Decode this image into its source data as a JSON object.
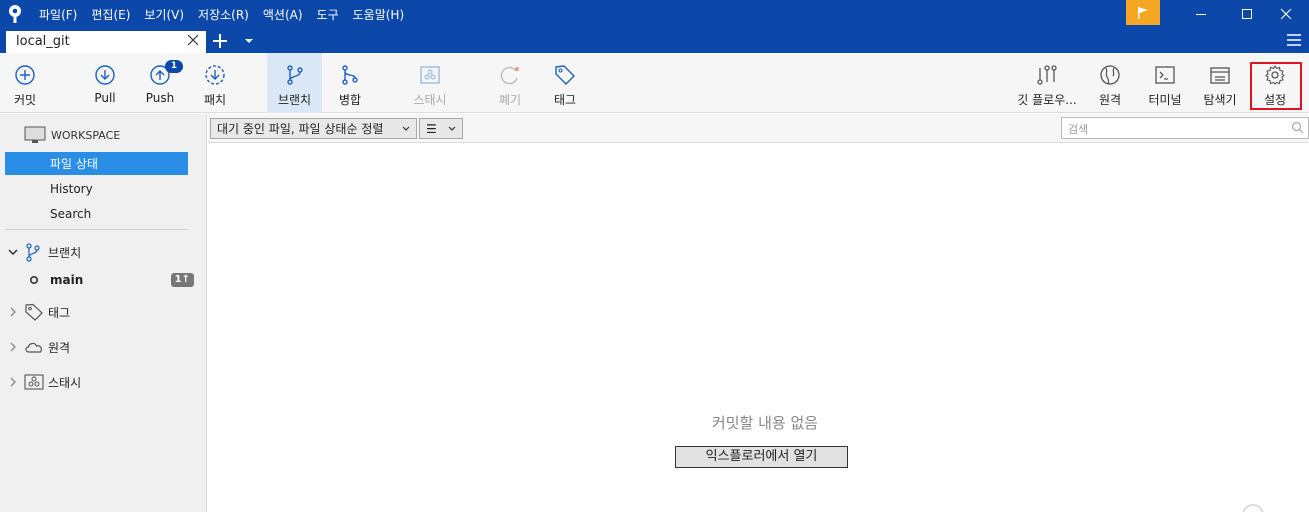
{
  "menubar": {
    "items": [
      "파일(F)",
      "편집(E)",
      "보기(V)",
      "저장소(R)",
      "액션(A)",
      "도구",
      "도움말(H)"
    ]
  },
  "tabs": {
    "active_tab": "local_git"
  },
  "toolbar": {
    "commit": "커밋",
    "pull": "Pull",
    "push": "Push",
    "push_badge": "1",
    "fetch": "패치",
    "branch": "브랜치",
    "merge": "병합",
    "stash": "스태시",
    "discard": "폐기",
    "tag": "태그",
    "git_flow": "깃 플로우...",
    "remote": "원격",
    "terminal": "터미널",
    "explorer": "탐색기",
    "settings": "설정"
  },
  "sidebar": {
    "workspace_header": "WORKSPACE",
    "workspace_items": [
      "파일 상태",
      "History",
      "Search"
    ],
    "selected_item": "파일 상태",
    "branches_header": "브랜치",
    "branch_main": "main",
    "branch_main_badge": "1↑",
    "tags_header": "태그",
    "remotes_header": "원격",
    "stashes_header": "스태시"
  },
  "filterbar": {
    "sort_dropdown": "대기 중인 파일, 파일 상태순 정렬",
    "view_dropdown": "☰",
    "search_placeholder": "검색"
  },
  "main": {
    "empty_message": "커밋할 내용 없음",
    "open_explorer_button": "익스플로러에서 열기"
  },
  "colors": {
    "titlebar": "#0b48a9",
    "selection": "#2a8ee6",
    "flag": "#f5a623",
    "highlight_border": "#e0141e"
  }
}
